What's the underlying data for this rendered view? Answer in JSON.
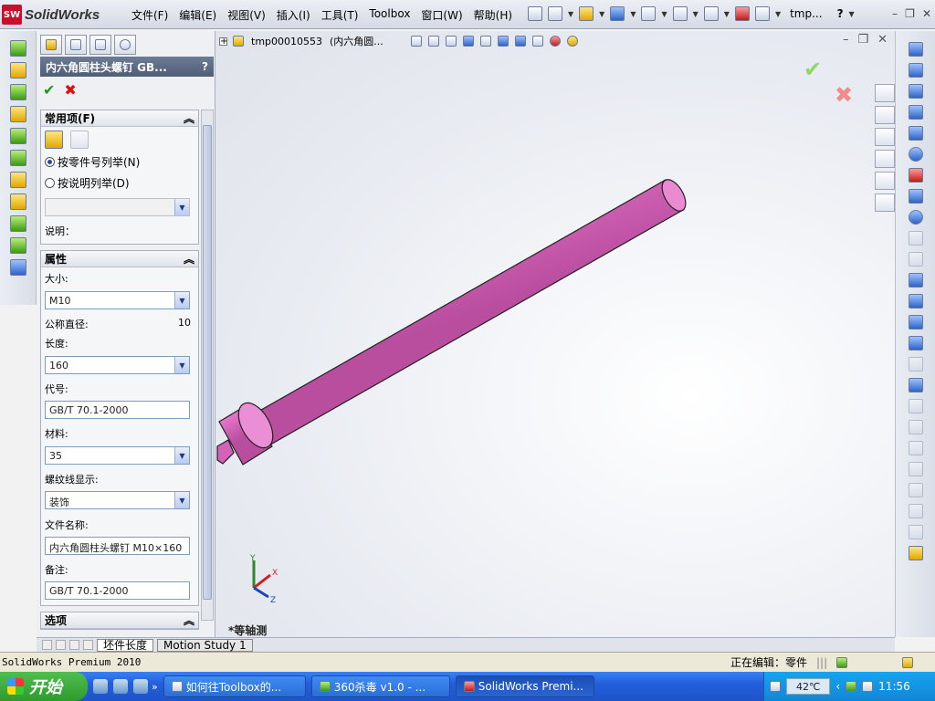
{
  "app": {
    "logo_text": "SolidWorks",
    "logo_badge": "SW",
    "menu": [
      "文件(F)",
      "编辑(E)",
      "视图(V)",
      "插入(I)",
      "工具(T)",
      "Toolbox",
      "窗口(W)",
      "帮助(H)"
    ],
    "title_tab": "tmp...",
    "help_symbol": "?"
  },
  "document": {
    "tab_name": "tmp00010553",
    "tab_desc": "(内六角圆...",
    "view_name": "*等轴测"
  },
  "property_manager": {
    "title": "内六角圆柱头螺钉 GB...",
    "help": "?",
    "ok": "✔",
    "cancel": "✖",
    "common_group": {
      "title": "常用项(F)",
      "radio_by_part": "按零件号列举(N)",
      "radio_by_desc": "按说明列举(D)",
      "radio_selected": "by_part",
      "desc_label": "说明："
    },
    "properties_group": {
      "title": "属性",
      "size_label": "大小:",
      "size_value": "M10",
      "nominal_diameter_label": "公称直径:",
      "nominal_diameter_value": "10",
      "length_label": "长度:",
      "length_value": "160",
      "code_label": "代号:",
      "code_value": "GB/T 70.1-2000",
      "material_label": "材料:",
      "material_value": "35",
      "thread_display_label": "螺纹线显示:",
      "thread_display_value": "装饰",
      "filename_label": "文件名称:",
      "filename_value": "内六角圆柱头螺钉 M10×160",
      "remark_label": "备注:",
      "remark_value": "GB/T 70.1-2000"
    },
    "options_group": {
      "title": "选项"
    }
  },
  "bottom_tabs": [
    "坯件长度",
    "Motion Study 1"
  ],
  "status_bar": {
    "product": "SolidWorks Premium 2010",
    "editing": "正在编辑：零件"
  },
  "taskbar": {
    "start": "开始",
    "tasks": [
      "如何往Toolbox的...",
      "360杀毒 v1.0 - ...",
      "SolidWorks Premi..."
    ],
    "active_task_index": 2,
    "temperature": "42℃",
    "clock": "11:56"
  },
  "model": {
    "color": "#e070c4"
  }
}
